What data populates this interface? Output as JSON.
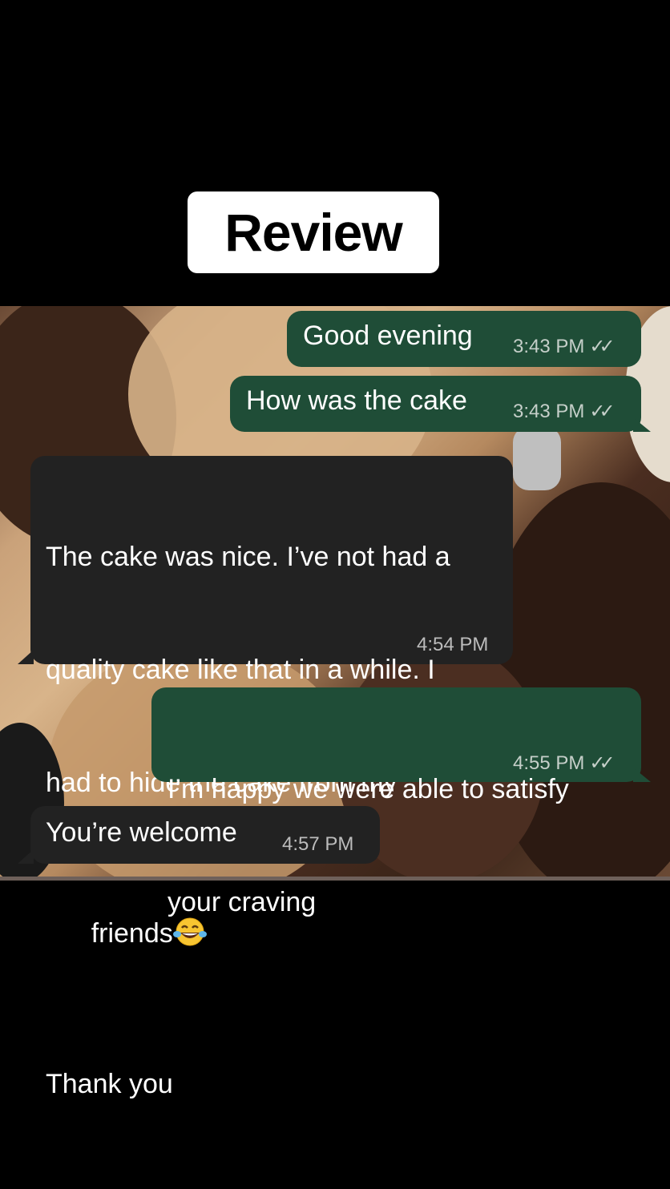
{
  "header": {
    "title": "Review"
  },
  "messages": [
    {
      "direction": "outgoing",
      "text": "Good evening",
      "time": "3:43 PM",
      "status": "double-check"
    },
    {
      "direction": "outgoing",
      "text": "How was the cake",
      "time": "3:43 PM",
      "status": "double-check"
    },
    {
      "direction": "incoming",
      "text_lines": [
        "The cake was nice. I’ve not had a",
        "quality cake like that in a while. I",
        "had to hide the cake from my",
        "friends",
        "Thank you"
      ],
      "emoji": "face-with-tears-of-joy",
      "time": "4:54 PM"
    },
    {
      "direction": "outgoing",
      "text_lines": [
        "I’m happy we were able to satisfy",
        "your craving"
      ],
      "time": "4:55 PM",
      "status": "double-check"
    },
    {
      "direction": "incoming",
      "text": "You’re welcome",
      "time": "4:57 PM"
    }
  ],
  "colors": {
    "outgoing_bubble": "#1f4d37",
    "incoming_bubble": "#222222",
    "background": "#000000"
  }
}
